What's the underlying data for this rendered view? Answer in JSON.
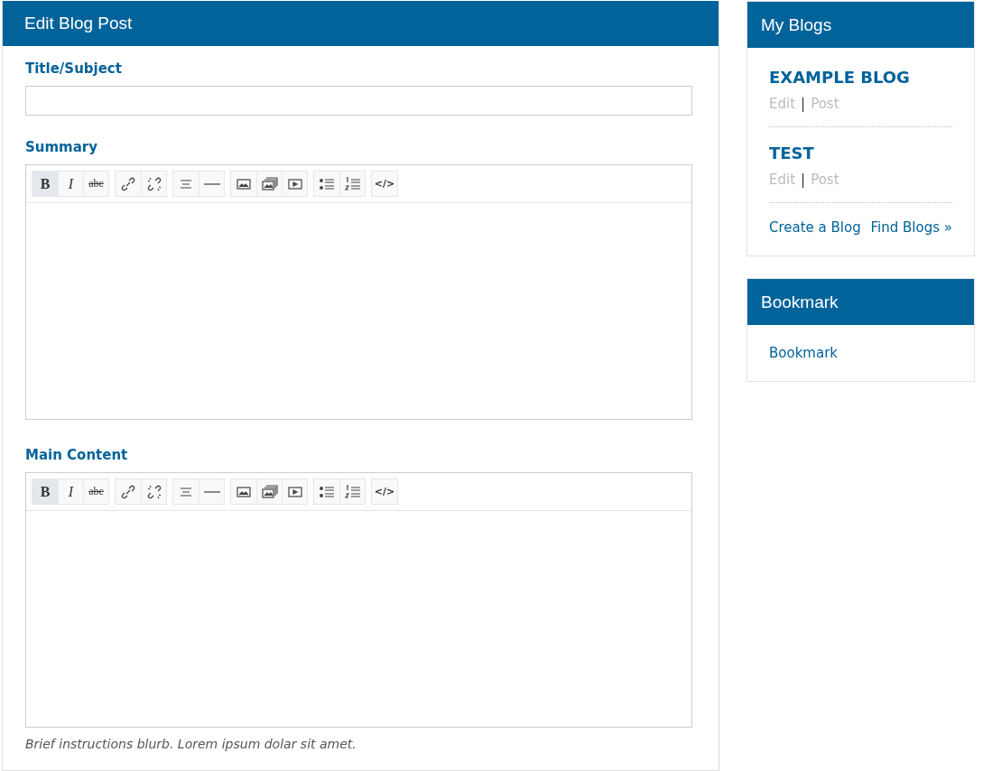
{
  "main": {
    "title": "Edit Blog Post",
    "title_field": {
      "label": "Title/Subject"
    },
    "editors": [
      {
        "label": "Summary",
        "toolbar": [
          [
            {
              "kind": "bold",
              "label": "B",
              "active": true
            },
            {
              "kind": "italic",
              "label": "I",
              "active": false
            },
            {
              "kind": "strike",
              "label": "abc",
              "active": false
            }
          ],
          [
            {
              "kind": "link",
              "active": false
            },
            {
              "kind": "unlink",
              "active": false
            }
          ],
          [
            {
              "kind": "align",
              "active": false
            },
            {
              "kind": "rule",
              "active": false
            }
          ],
          [
            {
              "kind": "image",
              "active": false
            },
            {
              "kind": "gallery",
              "active": false
            },
            {
              "kind": "video",
              "active": false
            }
          ],
          [
            {
              "kind": "bullets",
              "active": false
            },
            {
              "kind": "numbers",
              "active": false
            }
          ],
          [
            {
              "kind": "code",
              "label": "</>",
              "active": false
            }
          ]
        ]
      },
      {
        "label": "Main Content",
        "toolbar": [
          [
            {
              "kind": "bold",
              "label": "B",
              "active": true
            },
            {
              "kind": "italic",
              "label": "I",
              "active": false
            },
            {
              "kind": "strike",
              "label": "abc",
              "active": false
            }
          ],
          [
            {
              "kind": "link",
              "active": false
            },
            {
              "kind": "unlink",
              "active": false
            }
          ],
          [
            {
              "kind": "align",
              "active": false
            },
            {
              "kind": "rule",
              "active": false
            }
          ],
          [
            {
              "kind": "image",
              "active": false
            },
            {
              "kind": "gallery",
              "active": false
            },
            {
              "kind": "video",
              "active": false
            }
          ],
          [
            {
              "kind": "bullets",
              "active": false
            },
            {
              "kind": "numbers",
              "active": false
            }
          ],
          [
            {
              "kind": "code",
              "label": "</>",
              "active": false
            }
          ]
        ],
        "help": "Brief instructions blurb. Lorem ipsum dolar sit amet."
      }
    ]
  },
  "sidebar": {
    "my_blogs": {
      "title": "My Blogs",
      "blogs": [
        {
          "name": "EXAMPLE BLOG",
          "edit": "Edit",
          "separator": "|",
          "post": "Post"
        },
        {
          "name": "TEST",
          "edit": "Edit",
          "separator": "|",
          "post": "Post"
        }
      ],
      "links": [
        "Create a Blog",
        "Find Blogs »"
      ]
    },
    "bookmark": {
      "title": "Bookmark",
      "link": "Bookmark"
    }
  }
}
